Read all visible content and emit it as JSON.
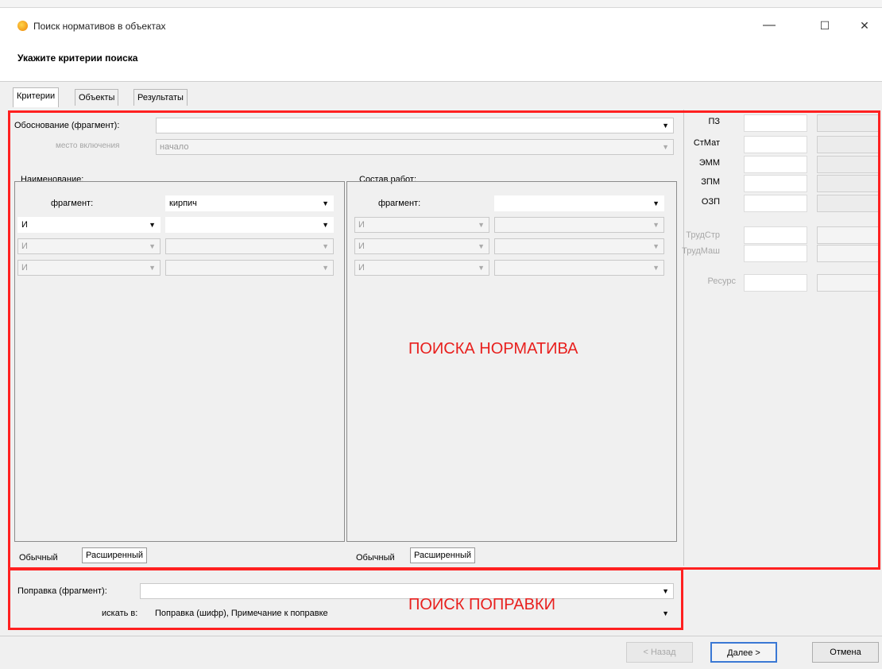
{
  "window": {
    "title": "Поиск нормативов в объектах",
    "subtitle": "Укажите критерии поиска",
    "controls": {
      "minimize": "—",
      "maximize": "☐",
      "close": "✕"
    }
  },
  "tabs": [
    "Критерии",
    "Объекты",
    "Результаты"
  ],
  "criteria": {
    "obosnovanie_label": "Обоснование (фрагмент):",
    "obosnovanie_value": "",
    "mesto_label": "место включения",
    "mesto_value": "начало",
    "naimenovanie": {
      "label": "Наименование:",
      "fragment_label": "фрагмент:",
      "fragment_value": "кирпич",
      "rows": [
        {
          "op": "И",
          "value": "",
          "enabled": true
        },
        {
          "op": "И",
          "value": "",
          "enabled": false
        },
        {
          "op": "И",
          "value": "",
          "enabled": false
        }
      ],
      "subtabs": [
        "Обычный",
        "Расширенный"
      ]
    },
    "sostav": {
      "label": "Состав работ:",
      "fragment_label": "фрагмент:",
      "fragment_value": "",
      "rows": [
        {
          "op": "И",
          "value": "",
          "enabled": false
        },
        {
          "op": "И",
          "value": "",
          "enabled": false
        },
        {
          "op": "И",
          "value": "",
          "enabled": false
        }
      ],
      "subtabs": [
        "Обычный",
        "Расширенный"
      ]
    }
  },
  "right_panel": {
    "fields": [
      "ПЗ",
      "СтМат",
      "ЭММ",
      "ЗПМ",
      "ОЗП"
    ],
    "fields_disabled": [
      "ТрудСтр",
      "ТрудМаш"
    ],
    "resurs": "Ресурс"
  },
  "correction": {
    "label": "Поправка (фрагмент):",
    "value": "",
    "search_in_label": "искать в:",
    "search_in_value": "Поправка (шифр), Примечание к поправке"
  },
  "annotations": {
    "search_normative": "ПОИСКА НОРМАТИВА",
    "search_correction": "ПОИСК ПОПРАВКИ"
  },
  "buttons": {
    "back": "< Назад",
    "next": "Далее >",
    "cancel": "Отмена"
  },
  "colors": {
    "annotation_red": "#ff2020",
    "window_bg": "#f0f0f0",
    "icon_orange": "#f29b1a"
  }
}
